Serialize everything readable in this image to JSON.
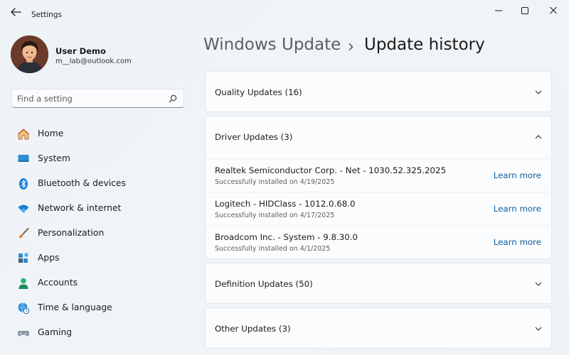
{
  "window": {
    "title": "Settings",
    "controls": [
      "minimize-icon",
      "maximize-icon",
      "close-icon"
    ]
  },
  "user": {
    "name": "User Demo",
    "email": "m__lab@outlook.com"
  },
  "search": {
    "placeholder": "Find a setting",
    "value": ""
  },
  "nav": {
    "items": [
      {
        "label": "Home",
        "icon": "home-icon"
      },
      {
        "label": "System",
        "icon": "system-icon"
      },
      {
        "label": "Bluetooth & devices",
        "icon": "bluetooth-icon"
      },
      {
        "label": "Network & internet",
        "icon": "wifi-icon"
      },
      {
        "label": "Personalization",
        "icon": "brush-icon"
      },
      {
        "label": "Apps",
        "icon": "apps-icon"
      },
      {
        "label": "Accounts",
        "icon": "accounts-icon"
      },
      {
        "label": "Time & language",
        "icon": "globe-clock-icon"
      },
      {
        "label": "Gaming",
        "icon": "gamepad-icon"
      }
    ]
  },
  "breadcrumb": {
    "parent": "Windows Update",
    "current": "Update history"
  },
  "sections": [
    {
      "title": "Quality Updates (16)",
      "expanded": false
    },
    {
      "title": "Driver Updates (3)",
      "expanded": true,
      "updates": [
        {
          "name": "Realtek Semiconductor Corp. - Net - 1030.52.325.2025",
          "status": "Successfully installed on 4/19/2025",
          "link": "Learn more"
        },
        {
          "name": "Logitech - HIDClass - 1012.0.68.0",
          "status": "Successfully installed on 4/17/2025",
          "link": "Learn more"
        },
        {
          "name": "Broadcom Inc. - System - 9.8.30.0",
          "status": "Successfully installed on 4/1/2025",
          "link": "Learn more"
        }
      ]
    },
    {
      "title": "Definition Updates (50)",
      "expanded": false
    },
    {
      "title": "Other Updates (3)",
      "expanded": false
    }
  ],
  "colors": {
    "accent": "#0067c0",
    "link": "#0f5ea5",
    "background": "#eff3f7",
    "card": "#fbfcfd"
  }
}
